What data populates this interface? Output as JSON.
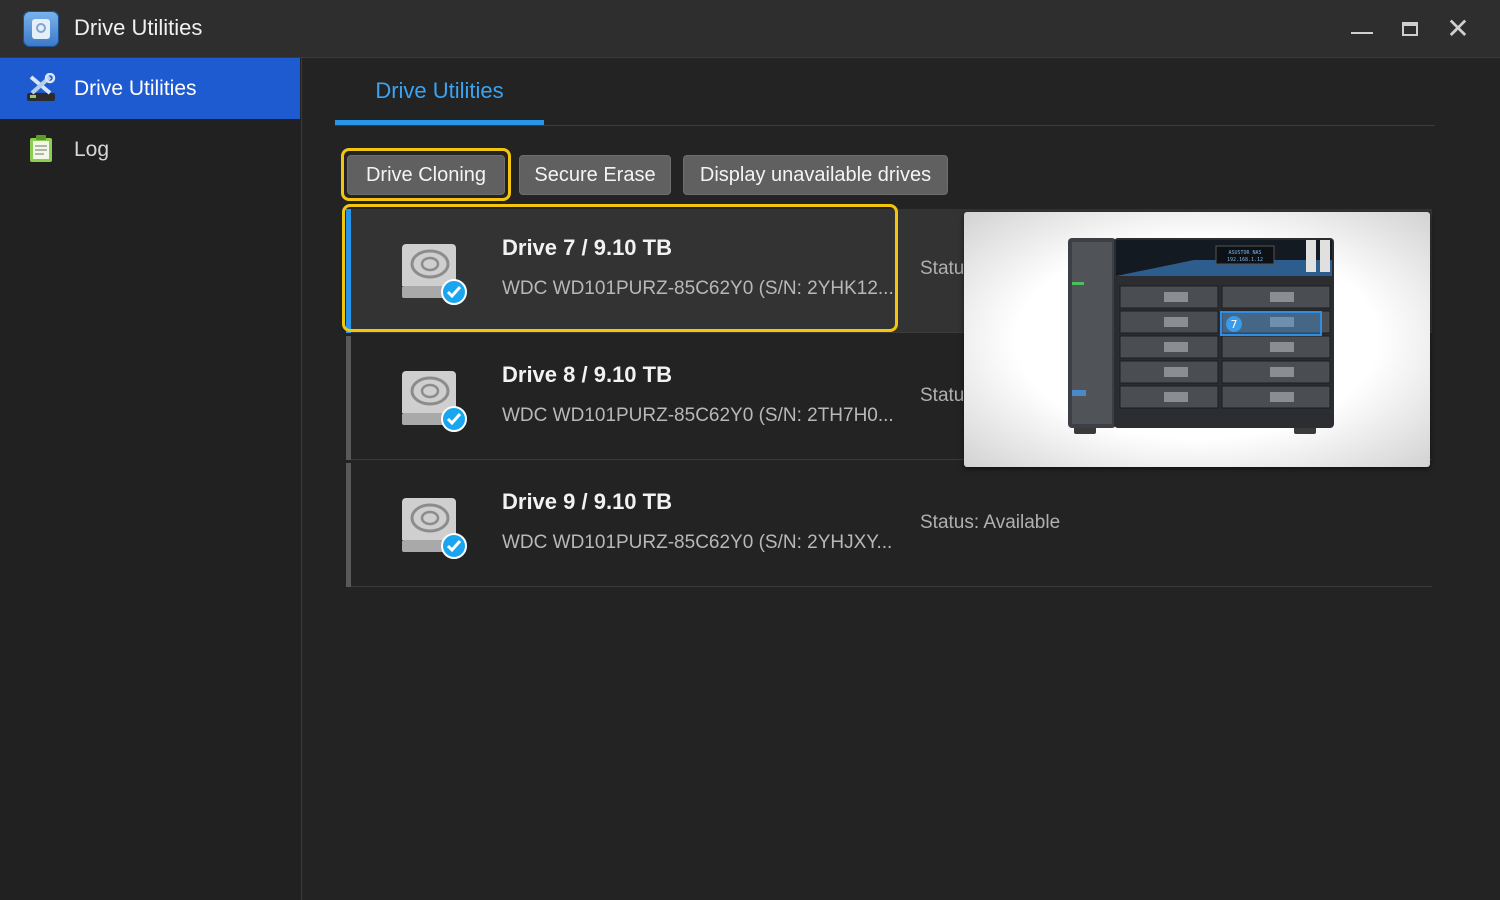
{
  "window": {
    "title": "Drive Utilities",
    "icons": [
      "app-icon",
      "minimize-icon",
      "maximize-icon",
      "close-icon"
    ]
  },
  "sidebar": {
    "items": [
      {
        "label": "Drive Utilities",
        "icon": "tools-icon",
        "active": true
      },
      {
        "label": "Log",
        "icon": "log-icon",
        "active": false
      }
    ]
  },
  "main": {
    "tab": "Drive Utilities",
    "buttons": {
      "clone": "Drive Cloning",
      "erase": "Secure Erase",
      "unavailable": "Display unavailable drives"
    },
    "drives": [
      {
        "title": "Drive 7 / 9.10 TB",
        "model": "WDC WD101PURZ-85C62Y0 (S/N: 2YHK12...",
        "status": "Status: Available",
        "selected": true
      },
      {
        "title": "Drive 8 / 9.10 TB",
        "model": "WDC WD101PURZ-85C62Y0 (S/N: 2TH7H0...",
        "status": "Status: Available",
        "selected": false
      },
      {
        "title": "Drive 9 / 9.10 TB",
        "model": "WDC WD101PURZ-85C62Y0 (S/N: 2YHJXY...",
        "status": "Status: Available",
        "selected": false
      }
    ],
    "nas_preview": {
      "bay_label": "7",
      "screen_text": [
        "ASUSTOR NAS",
        "192.168.1.12"
      ]
    }
  },
  "colors": {
    "accent": "#2795ea",
    "sidebar_active": "#1f5bd0",
    "highlight": "#f3c50f",
    "background": "#232323"
  }
}
